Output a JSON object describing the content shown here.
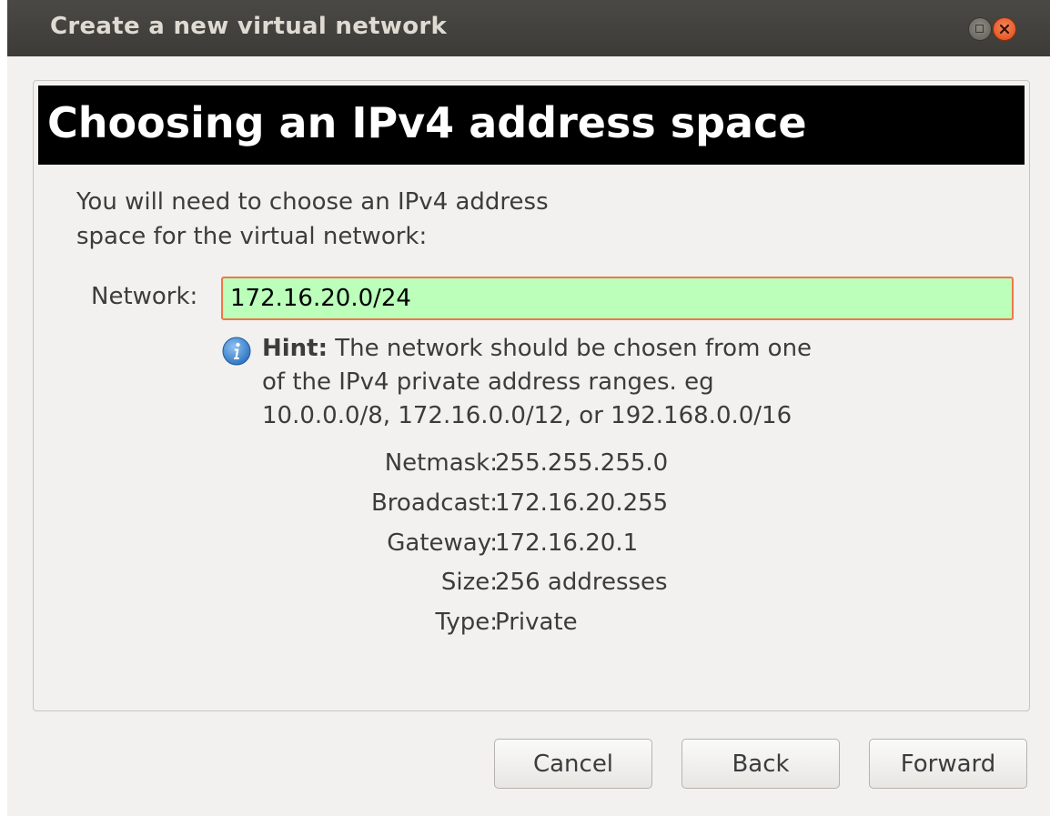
{
  "window": {
    "title": "Create a new virtual network"
  },
  "banner": {
    "title": "Choosing an IPv4 address space"
  },
  "intro": {
    "line1": "You will need to choose an IPv4 address",
    "line2": "space for the virtual network:"
  },
  "network": {
    "label": "Network:",
    "value": "172.16.20.0/24"
  },
  "hint": {
    "bold": "Hint:",
    "line1": " The network should be chosen from one",
    "line2": "of the IPv4 private address ranges. eg",
    "line3": "10.0.0.0/8,  172.16.0.0/12, or 192.168.0.0/16"
  },
  "info": [
    {
      "label": "Netmask:",
      "value": "255.255.255.0"
    },
    {
      "label": "Broadcast:",
      "value": "172.16.20.255"
    },
    {
      "label": "Gateway:",
      "value": "172.16.20.1"
    },
    {
      "label": "Size:",
      "value": "256 addresses"
    },
    {
      "label": "Type:",
      "value": "Private"
    }
  ],
  "buttons": {
    "cancel": "Cancel",
    "back": "Back",
    "forward": "Forward"
  },
  "icons": {
    "hint": "info-icon",
    "maximize": "maximize-icon",
    "close": "close-icon"
  },
  "colors": {
    "valid_input_bg": "#bbffbb",
    "focus_border": "#f07746",
    "banner_bg": "#000000"
  }
}
